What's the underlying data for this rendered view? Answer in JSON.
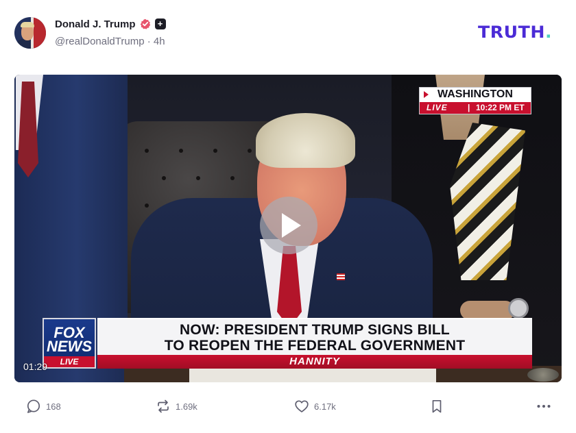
{
  "post": {
    "author": {
      "display_name": "Donald J. Trump",
      "handle": "@realDonaldTrump",
      "time": "4h",
      "separator": "·",
      "verified_icon": "verified-badge-icon",
      "subscriber_icon": "plus-badge-icon"
    },
    "brand": {
      "logo_text": "TRUTH",
      "logo_dot": ".",
      "color": "#4b2bd6",
      "dot_color": "#4fd0c2"
    },
    "video": {
      "timestamp": "01:29",
      "play_icon": "play-icon",
      "overlay": {
        "location": "WASHINGTON",
        "live_label": "LIVE",
        "separator": "|",
        "time": "10:22 PM ET",
        "network_lines": [
          "FOX",
          "NEWS"
        ],
        "network_live": "LIVE",
        "headline_line1": "NOW: PRESIDENT TRUMP SIGNS BILL",
        "headline_line2": "TO REOPEN THE FEDERAL GOVERNMENT",
        "show_name": "HANNITY",
        "accent_red": "#c8102e",
        "fox_blue": "#0f2a6e"
      }
    },
    "actions": {
      "reply_count": "168",
      "retruth_count": "1.69k",
      "like_count": "6.17k",
      "icons": [
        "reply-icon",
        "retruth-icon",
        "like-icon",
        "bookmark-icon",
        "more-icon"
      ]
    }
  }
}
